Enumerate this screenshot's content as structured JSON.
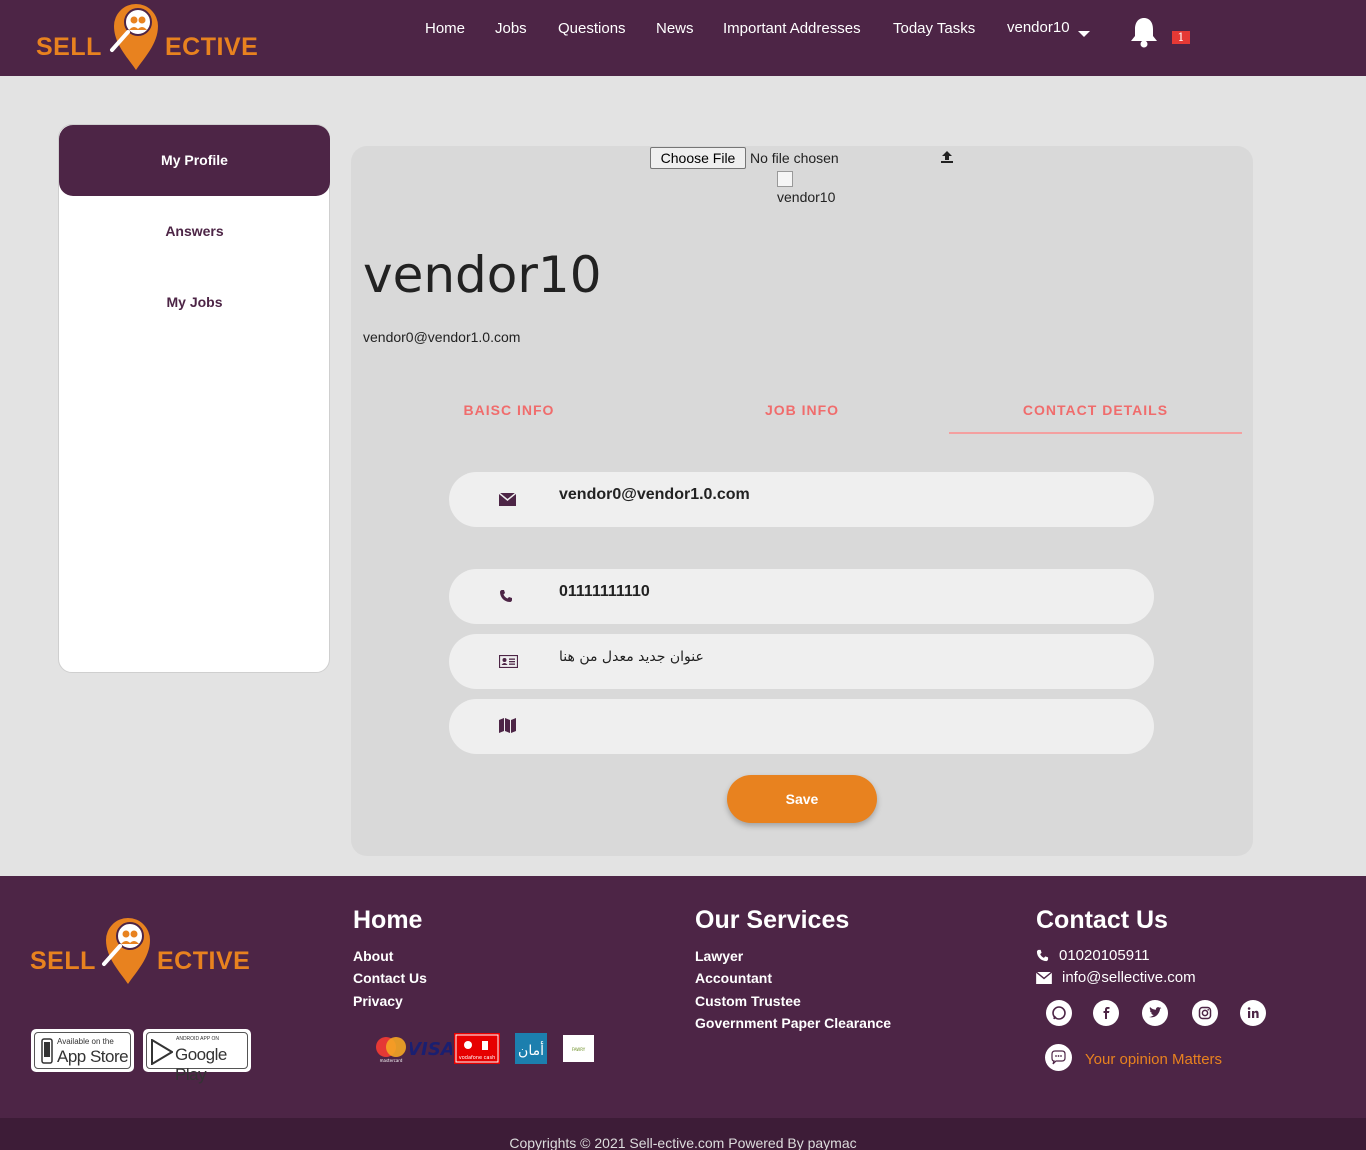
{
  "header": {
    "logo": {
      "left": "SELL",
      "right": "ECTIVE"
    },
    "nav": [
      "Home",
      "Jobs",
      "Questions",
      "News",
      "Important Addresses",
      "Today Tasks"
    ],
    "user_menu": "vendor10",
    "notification_count": "1"
  },
  "sidebar": {
    "items": [
      "My Profile",
      "Answers",
      "My Jobs"
    ],
    "active": "My Profile"
  },
  "profile": {
    "file_button": "Choose File",
    "file_status": "No file chosen",
    "avatar_alt": "vendor10",
    "name": "vendor10",
    "email": "vendor0@vendor1.0.com"
  },
  "tabs": {
    "items": [
      "BAISC INFO",
      "JOB INFO",
      "CONTACT DETAILS"
    ],
    "active": "CONTACT DETAILS"
  },
  "contact_form": {
    "email": "vendor0@vendor1.0.com",
    "phone": "01111111110",
    "address": "عنوان جديد معدل من هنا",
    "map_location": "",
    "save_label": "Save"
  },
  "footer": {
    "logo": {
      "left": "SELL",
      "right": "ECTIVE"
    },
    "app_store": {
      "small": "Available on the",
      "big": "App Store"
    },
    "google_play": {
      "small": "ANDROID APP ON",
      "big": "Google Play"
    },
    "home": {
      "heading": "Home",
      "links": [
        "About",
        "Contact Us",
        "Privacy"
      ]
    },
    "services": {
      "heading": "Our Services",
      "links": [
        "Lawyer",
        "Accountant",
        "Custom Trustee",
        "Government Paper Clearance"
      ]
    },
    "contact": {
      "heading": "Contact Us",
      "phone": "01020105911",
      "email": "info@sellective.com"
    },
    "payment_logos": {
      "mastercard": "mastercard",
      "visa": "VISA",
      "vodafone": "vodafone cash",
      "aman": "أمان",
      "fawry": "FAWRY"
    },
    "social_icons": [
      "whatsapp-icon",
      "facebook-icon",
      "twitter-icon",
      "instagram-icon",
      "linkedin-icon"
    ],
    "opinion": "Your opinion Matters",
    "copyright": "Copyrights © 2021 Sell-ective.com Powered By paymac"
  },
  "colors": {
    "primary": "#4d2546",
    "accent": "#e8821f",
    "tab": "#f06c6c",
    "background": "#e3e3e3",
    "card": "#d9d9d9",
    "field": "#efefef"
  }
}
